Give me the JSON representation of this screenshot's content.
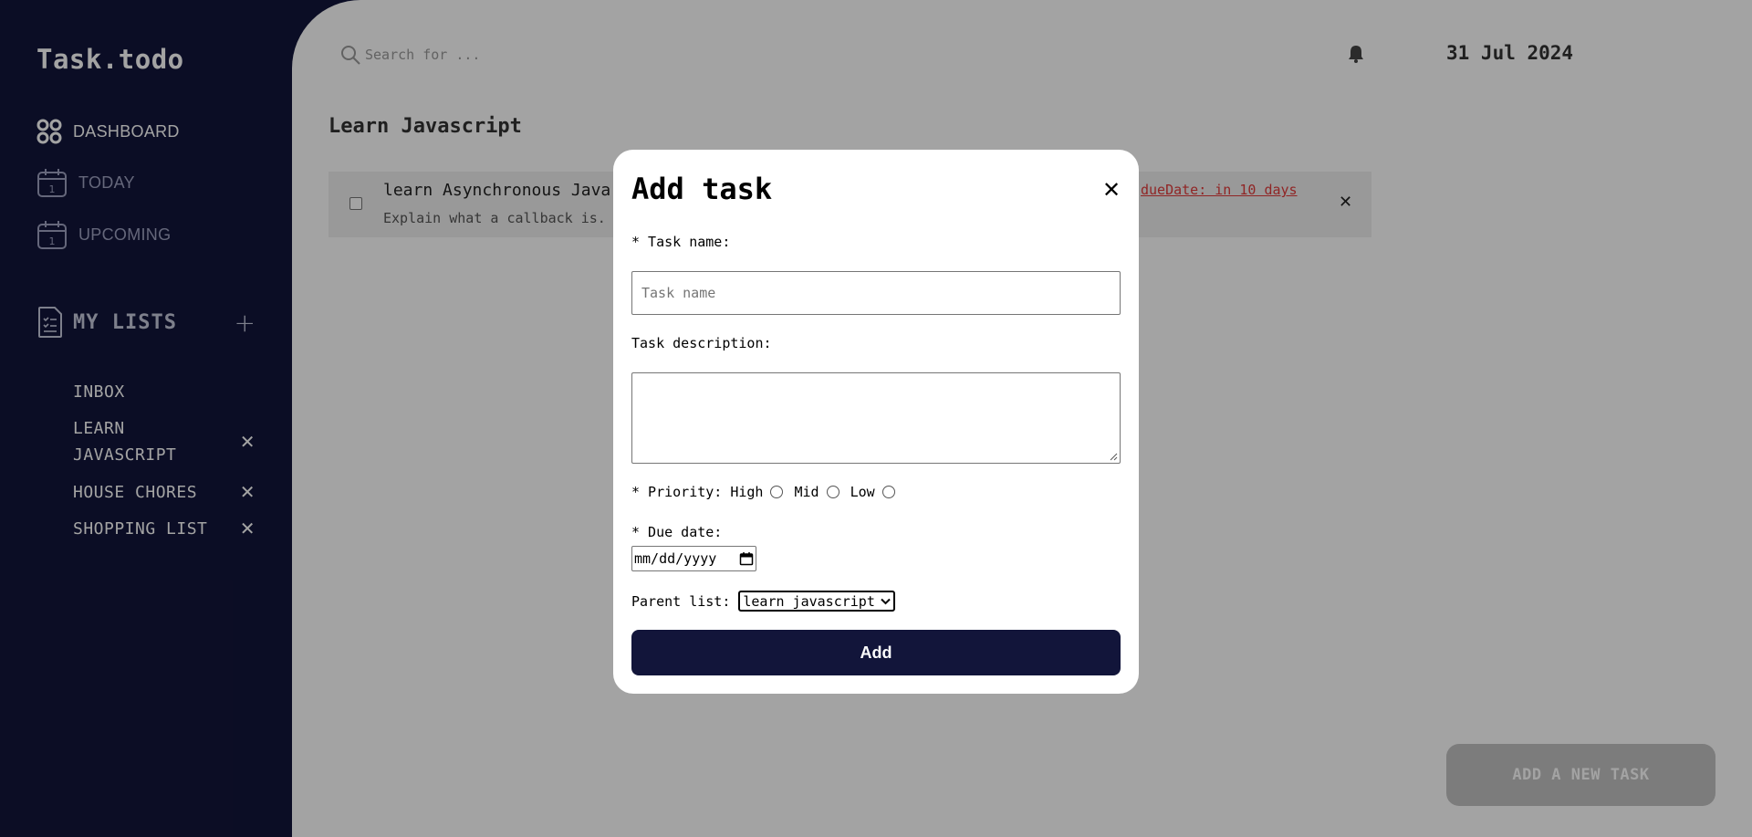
{
  "app": {
    "logo": "Task.todo"
  },
  "sidebar": {
    "nav": [
      {
        "label": "DASHBOARD",
        "icon": "dashboard-grid-icon"
      },
      {
        "label": "TODAY",
        "icon": "calendar-icon"
      },
      {
        "label": "UPCOMING",
        "icon": "calendar-icon"
      }
    ],
    "my_lists_label": "MY LISTS",
    "add_list_glyph": "+",
    "lists": [
      {
        "name": "INBOX",
        "removable": false
      },
      {
        "name": "LEARN JAVASCRIPT",
        "removable": true
      },
      {
        "name": "HOUSE CHORES",
        "removable": true
      },
      {
        "name": "SHOPPING LIST",
        "removable": true
      }
    ],
    "remove_glyph": "✕"
  },
  "header": {
    "search_placeholder": "Search for ...",
    "date": "31 Jul 2024"
  },
  "main": {
    "list_title": "Learn Javascript",
    "tasks": [
      {
        "title": "learn Asynchronous Java",
        "description": "Explain what a callback is.",
        "due": "dueDate: in 10 days",
        "close_glyph": "✕"
      }
    ],
    "add_new_label": "ADD A NEW TASK"
  },
  "modal": {
    "title": "Add task",
    "close_glyph": "✕",
    "task_name_label": "* Task name:",
    "task_name_placeholder": "Task name",
    "task_description_label": "Task description:",
    "priority_label": "* Priority:",
    "priority_options": [
      "High",
      "Mid",
      "Low"
    ],
    "due_date_label": "* Due date:",
    "due_date_placeholder": "mm/dd/yyyy",
    "parent_list_label": "Parent list:",
    "parent_list_value": "learn javascript",
    "add_button_label": "Add"
  },
  "colors": {
    "sidebar_bg": "#12153a",
    "accent": "#12153a",
    "due_text": "#e23b3b",
    "overlay": "rgba(0,0,0,0.36)"
  }
}
